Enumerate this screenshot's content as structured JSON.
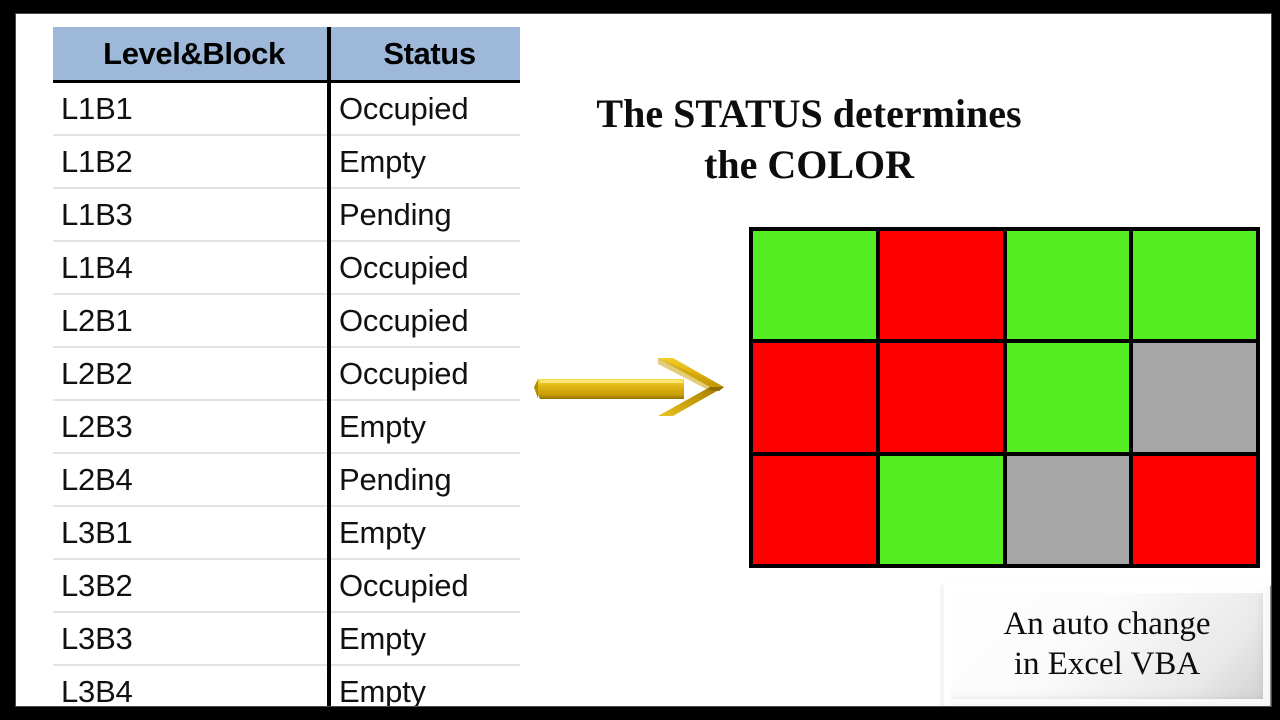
{
  "slide": {
    "background_color": "#ffffff",
    "letterbox_color": "#000000"
  },
  "table": {
    "name": "level-block-status-table",
    "header_background": "#9db8d9",
    "columns": [
      "Level&Block",
      "Status"
    ],
    "rows": [
      {
        "label": "L1B1",
        "status": "Occupied"
      },
      {
        "label": "L1B2",
        "status": "Empty"
      },
      {
        "label": "L1B3",
        "status": "Pending"
      },
      {
        "label": "L1B4",
        "status": "Occupied"
      },
      {
        "label": "L2B1",
        "status": "Occupied"
      },
      {
        "label": "L2B2",
        "status": "Occupied"
      },
      {
        "label": "L2B3",
        "status": "Empty"
      },
      {
        "label": "L2B4",
        "status": "Pending"
      },
      {
        "label": "L3B1",
        "status": "Empty"
      },
      {
        "label": "L3B2",
        "status": "Occupied"
      },
      {
        "label": "L3B3",
        "status": "Empty"
      },
      {
        "label": "L3B4",
        "status": "Empty"
      }
    ]
  },
  "headline": {
    "line1": "The STATUS determines",
    "line2": "the COLOR"
  },
  "arrow": {
    "name": "gold-right-arrow-icon",
    "color_light": "#f5d020",
    "color_mid": "#d4a90a",
    "color_dark": "#9c7a05"
  },
  "color_grid": {
    "name": "status-color-grid",
    "rows": 3,
    "columns": 4,
    "legend": {
      "Occupied": "#ff0000",
      "Empty": "#55ee22",
      "Pending": "#a6a6a6"
    },
    "cells": [
      {
        "status": "Empty",
        "color": "#55ee22"
      },
      {
        "status": "Occupied",
        "color": "#ff0000"
      },
      {
        "status": "Empty",
        "color": "#55ee22"
      },
      {
        "status": "Empty",
        "color": "#55ee22"
      },
      {
        "status": "Occupied",
        "color": "#ff0000"
      },
      {
        "status": "Occupied",
        "color": "#ff0000"
      },
      {
        "status": "Empty",
        "color": "#55ee22"
      },
      {
        "status": "Pending",
        "color": "#a6a6a6"
      },
      {
        "status": "Occupied",
        "color": "#ff0000"
      },
      {
        "status": "Empty",
        "color": "#55ee22"
      },
      {
        "status": "Pending",
        "color": "#a6a6a6"
      },
      {
        "status": "Occupied",
        "color": "#ff0000"
      }
    ]
  },
  "caption": {
    "line1": "An auto change",
    "line2": "in Excel VBA"
  }
}
